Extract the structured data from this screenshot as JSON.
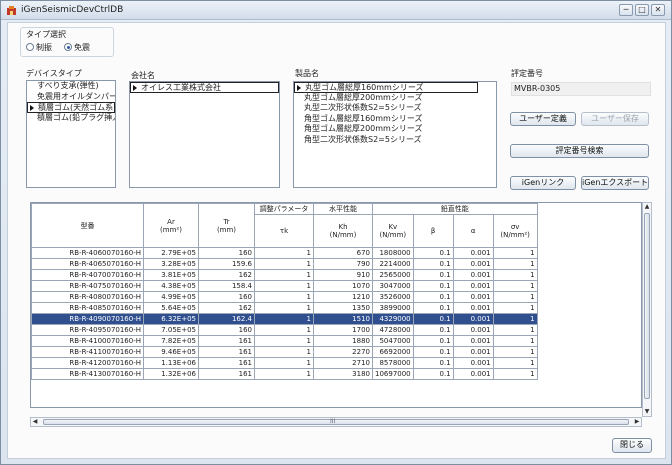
{
  "window": {
    "title": "iGenSeismicDevCtrlDB",
    "btn_min": "─",
    "btn_max": "□",
    "btn_close": "✕"
  },
  "type_select": {
    "label": "タイプ選択",
    "options": [
      "制振",
      "免震"
    ],
    "selected": "免震"
  },
  "device_type": {
    "label": "デバイスタイプ",
    "items": [
      "すべり支承(弾性)",
      "免震用オイルダンパー",
      "積層ゴム(天然ゴム系)",
      "積層ゴム(鉛プラグ挿入..."
    ],
    "selected_index": 2
  },
  "company": {
    "label": "会社名",
    "items": [
      "オイレス工業株式会社"
    ],
    "selected_index": 0
  },
  "product": {
    "label": "製品名",
    "items": [
      "丸型ゴム層総厚160mmシリーズ",
      "丸型ゴム層総厚200mmシリーズ",
      "丸型二次形状係数S2=5シリーズ",
      "角型ゴム層総厚160mmシリーズ",
      "角型ゴム層総厚200mmシリーズ",
      "角型二次形状係数S2=5シリーズ"
    ],
    "selected_index": 0
  },
  "cert": {
    "label": "評定番号",
    "value": "MVBR-0305"
  },
  "buttons": {
    "user_define": "ユーザー定義",
    "user_save": "ユーザー保存",
    "cert_search": "評定番号検索",
    "igen_link": "iGenリンク",
    "igen_export": "iGenエクスポート",
    "close": "閉じる"
  },
  "table": {
    "group_headers": {
      "adjust": "調整パラメータ",
      "horizontal": "水平性能",
      "vertical": "鉛直性能"
    },
    "columns": [
      "型番",
      "Ar\n(mm²)",
      "Tr\n(mm)",
      "τk",
      "Kh\n(N/mm)",
      "Kv\n(N/mm)",
      "β",
      "α",
      "σv\n(N/mm²)"
    ],
    "rows": [
      [
        "RB-R-4060070160-H",
        "2.79E+05",
        "160",
        "1",
        "670",
        "1808000",
        "0.1",
        "0.001",
        "1"
      ],
      [
        "RB-R-4065070160-H",
        "3.28E+05",
        "159.6",
        "1",
        "790",
        "2214000",
        "0.1",
        "0.001",
        "1"
      ],
      [
        "RB-R-4070070160-H",
        "3.81E+05",
        "162",
        "1",
        "910",
        "2565000",
        "0.1",
        "0.001",
        "1"
      ],
      [
        "RB-R-4075070160-H",
        "4.38E+05",
        "158.4",
        "1",
        "1070",
        "3047000",
        "0.1",
        "0.001",
        "1"
      ],
      [
        "RB-R-4080070160-H",
        "4.99E+05",
        "160",
        "1",
        "1210",
        "3526000",
        "0.1",
        "0.001",
        "1"
      ],
      [
        "RB-R-4085070160-H",
        "5.64E+05",
        "162",
        "1",
        "1350",
        "3899000",
        "0.1",
        "0.001",
        "1"
      ],
      [
        "RB-R-4090070160-H",
        "6.32E+05",
        "162.4",
        "1",
        "1510",
        "4329000",
        "0.1",
        "0.001",
        "1"
      ],
      [
        "RB-R-4095070160-H",
        "7.05E+05",
        "160",
        "1",
        "1700",
        "4728000",
        "0.1",
        "0.001",
        "1"
      ],
      [
        "RB-R-4100070160-H",
        "7.82E+05",
        "161",
        "1",
        "1880",
        "5047000",
        "0.1",
        "0.001",
        "1"
      ],
      [
        "RB-R-4110070160-H",
        "9.46E+05",
        "161",
        "1",
        "2270",
        "6692000",
        "0.1",
        "0.001",
        "1"
      ],
      [
        "RB-R-4120070160-H",
        "1.13E+06",
        "161",
        "1",
        "2710",
        "8578000",
        "0.1",
        "0.001",
        "1"
      ],
      [
        "RB-R-4130070160-H",
        "1.32E+06",
        "161",
        "1",
        "3180",
        "10697000",
        "0.1",
        "0.001",
        "1"
      ]
    ],
    "selected_row": 6
  },
  "scrollbar": {
    "h_grip": "III"
  },
  "colors": {
    "selection": "#2f4f8f",
    "window_bg": "#dfe7f1"
  }
}
